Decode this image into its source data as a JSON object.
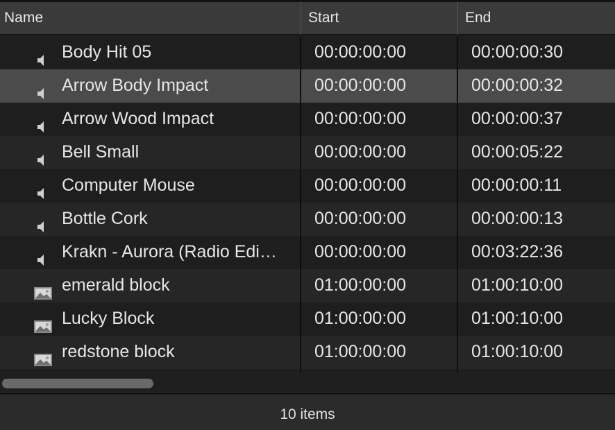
{
  "columns": {
    "name": "Name",
    "start": "Start",
    "end": "End"
  },
  "rows": [
    {
      "icon": "speaker-icon",
      "name": "Body Hit 05",
      "start": "00:00:00:00",
      "end": "00:00:00:30"
    },
    {
      "icon": "speaker-icon",
      "name": "Arrow Body Impact",
      "start": "00:00:00:00",
      "end": "00:00:00:32",
      "selected": true
    },
    {
      "icon": "speaker-icon",
      "name": "Arrow Wood Impact",
      "start": "00:00:00:00",
      "end": "00:00:00:37"
    },
    {
      "icon": "speaker-icon",
      "name": "Bell Small",
      "start": "00:00:00:00",
      "end": "00:00:05:22"
    },
    {
      "icon": "speaker-icon",
      "name": "Computer Mouse",
      "start": "00:00:00:00",
      "end": "00:00:00:11"
    },
    {
      "icon": "speaker-icon",
      "name": "Bottle Cork",
      "start": "00:00:00:00",
      "end": "00:00:00:13"
    },
    {
      "icon": "speaker-icon",
      "name": "Krakn - Aurora (Radio Edi…",
      "start": "00:00:00:00",
      "end": "00:03:22:36"
    },
    {
      "icon": "image-icon",
      "name": "emerald block",
      "start": "01:00:00:00",
      "end": "01:00:10:00"
    },
    {
      "icon": "image-icon",
      "name": "Lucky Block",
      "start": "01:00:00:00",
      "end": "01:00:10:00"
    },
    {
      "icon": "image-icon",
      "name": "redstone block",
      "start": "01:00:00:00",
      "end": "01:00:10:00"
    }
  ],
  "footer": {
    "item_count": "10 items"
  },
  "colors": {
    "selected_row": "#4b4b4b",
    "header": "#3a3a3a",
    "background": "#1e1e1e"
  }
}
